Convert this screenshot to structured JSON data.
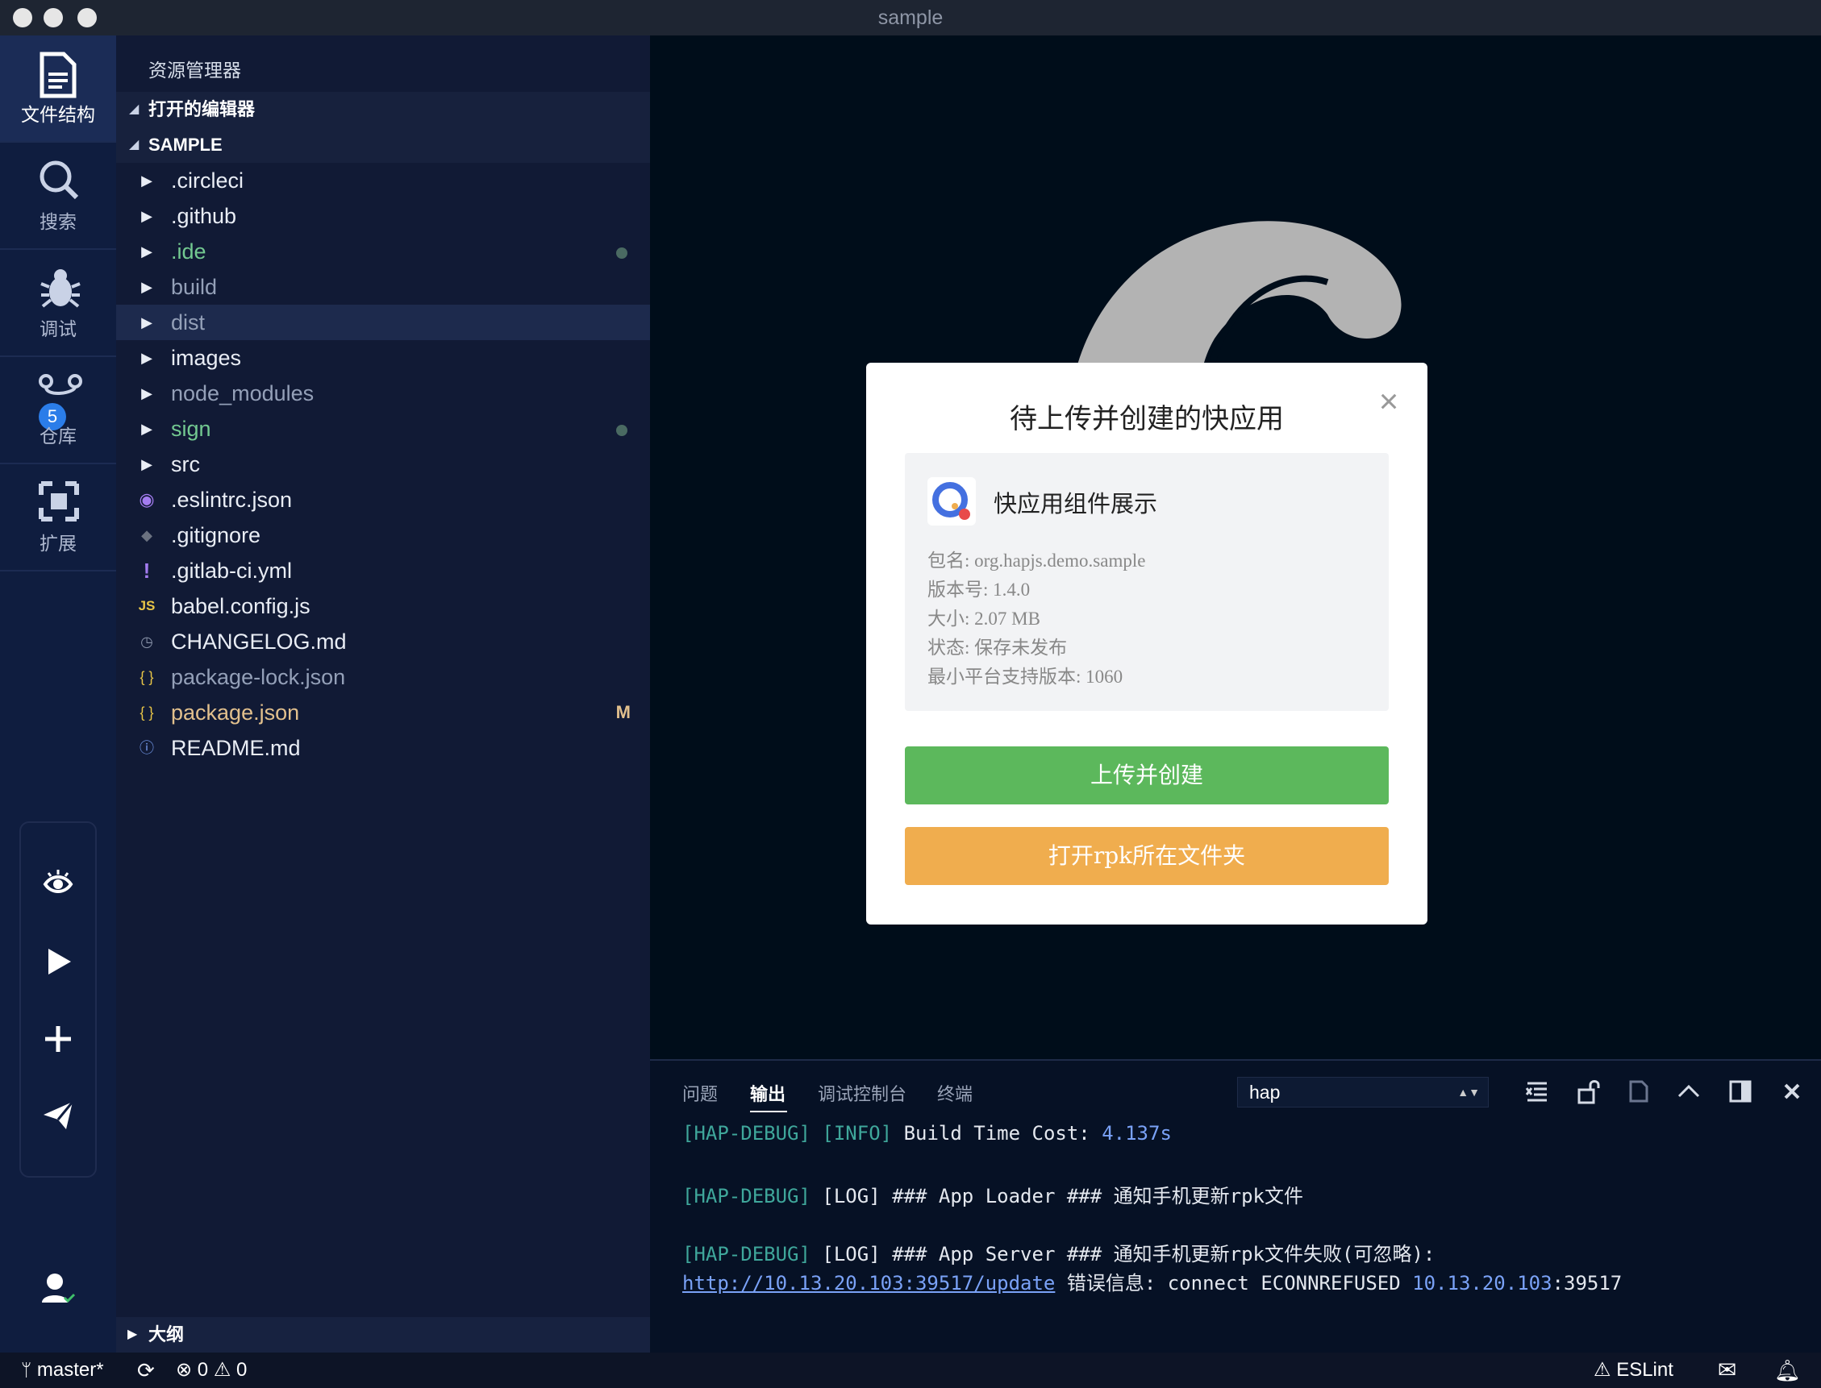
{
  "window": {
    "title": "sample"
  },
  "activity": {
    "items": [
      {
        "label": "文件结构",
        "icon": "file-icon"
      },
      {
        "label": "搜索",
        "icon": "search-icon"
      },
      {
        "label": "调试",
        "icon": "bug-icon"
      },
      {
        "label": "仓库",
        "icon": "source-control-icon",
        "badge": "5"
      },
      {
        "label": "扩展",
        "icon": "extensions-icon"
      }
    ],
    "quick_icons": [
      "eye-icon",
      "play-icon",
      "plus-icon",
      "send-icon"
    ],
    "account_icon": "account-icon"
  },
  "sidebar": {
    "title": "资源管理器",
    "open_editors": "打开的编辑器",
    "project": "SAMPLE",
    "files": [
      {
        "name": ".circleci",
        "type": "folder"
      },
      {
        "name": ".github",
        "type": "folder"
      },
      {
        "name": ".ide",
        "type": "folder",
        "status": "dot"
      },
      {
        "name": "build",
        "type": "folder"
      },
      {
        "name": "dist",
        "type": "folder"
      },
      {
        "name": "images",
        "type": "folder"
      },
      {
        "name": "node_modules",
        "type": "folder"
      },
      {
        "name": "sign",
        "type": "folder",
        "status": "dot"
      },
      {
        "name": "src",
        "type": "folder"
      },
      {
        "name": ".eslintrc.json",
        "type": "file"
      },
      {
        "name": ".gitignore",
        "type": "file"
      },
      {
        "name": ".gitlab-ci.yml",
        "type": "file"
      },
      {
        "name": "babel.config.js",
        "type": "file",
        "icon_text": "JS"
      },
      {
        "name": "CHANGELOG.md",
        "type": "file"
      },
      {
        "name": "package-lock.json",
        "type": "file",
        "icon_text": "{ }"
      },
      {
        "name": "package.json",
        "type": "file",
        "icon_text": "{ }",
        "status": "M"
      },
      {
        "name": "README.md",
        "type": "file"
      }
    ],
    "outline": "大纲"
  },
  "modal": {
    "title": "待上传并创建的快应用",
    "app_name": "快应用组件展示",
    "info": [
      "包名: org.hapjs.demo.sample",
      "版本号: 1.4.0",
      "大小: 2.07 MB",
      "状态: 保存未发布",
      "最小平台支持版本: 1060"
    ],
    "primary_button": "上传并创建",
    "secondary_button": "打开rpk所在文件夹",
    "colors": {
      "primary": "#5cb85c",
      "secondary": "#f0ad4e"
    }
  },
  "panel": {
    "tabs": [
      "问题",
      "输出",
      "调试控制台",
      "终端"
    ],
    "active_tab": "输出",
    "channel": "hap",
    "lines": {
      "l1": {
        "tag": "[HAP-DEBUG]",
        "level": "[INFO]",
        "text": "Build Time Cost: ",
        "value": "4.137s"
      },
      "l2": {
        "tag": "[HAP-DEBUG]",
        "level": "[LOG]",
        "text": "### App Loader ### 通知手机更新rpk文件"
      },
      "l3": {
        "tag": "[HAP-DEBUG]",
        "level": "[LOG]",
        "text": "### App Server ### 通知手机更新rpk文件失败(可忽略):"
      },
      "l4": {
        "link": "http://10.13.20.103:39517/update",
        "text": " 错误信息: connect ECONNREFUSED ",
        "ip": "10.13.20.103",
        "port": ":39517"
      }
    }
  },
  "status": {
    "branch": "master*",
    "errors": "0",
    "warnings": "0",
    "eslint": "ESLint"
  }
}
